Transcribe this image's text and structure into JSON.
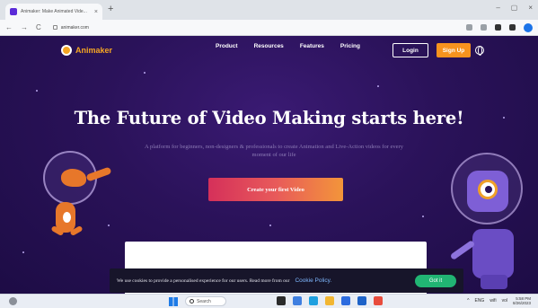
{
  "browser": {
    "tab_title": "Animaker: Make Animated Vide...",
    "tab_close": "×",
    "new_tab": "+",
    "url": "animaker.com",
    "back": "←",
    "forward": "→",
    "reload": "C",
    "minimize": "–",
    "maximize": "▢",
    "close": "×"
  },
  "site": {
    "logo_text": "Animaker",
    "nav": [
      "Product",
      "Resources",
      "Features",
      "Pricing"
    ],
    "login_label": "Login",
    "signup_label": "Sign Up",
    "headline": "The Future of Video Making starts here!",
    "subtitle": "A platform for beginners, non-designers & professionals to create Animation and Live-Action videos for every moment of our life",
    "cta_label": "Create your first Video"
  },
  "cookie": {
    "text": "We use cookies to provide a personalised experience for our users. Read more from our",
    "link": "Cookie Policy.",
    "button": "Got it"
  },
  "taskbar": {
    "search_label": "Search",
    "tray_items": [
      "^",
      "ENG",
      "wifi",
      "vol"
    ],
    "time": "5:58 PM",
    "date": "8/26/2023"
  },
  "colors": {
    "accent_orange": "#f7931e",
    "page_bg": "#2a1259",
    "cookie_accept": "#21b573"
  }
}
